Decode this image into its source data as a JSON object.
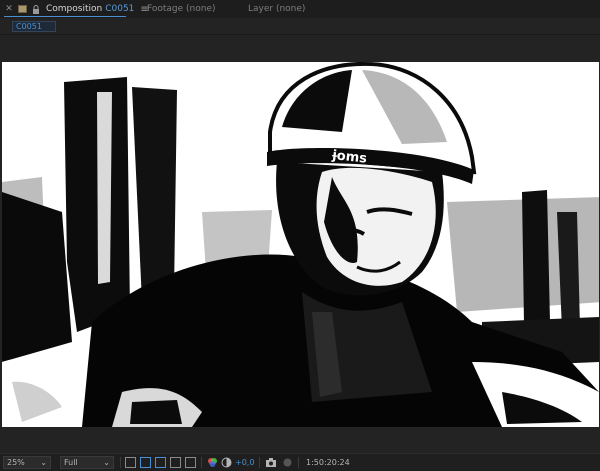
{
  "tabs": {
    "composition": {
      "title": "Composition",
      "name": "C0051",
      "menu_icon": "hamburger-menu-icon"
    },
    "footage": {
      "label": "Footage (none)"
    },
    "layer": {
      "label": "Layer (none)"
    }
  },
  "breadcrumb": {
    "label": "C0051"
  },
  "toolbar": {
    "zoom": "25%",
    "resolution": "Full",
    "exposure": "+0,0",
    "timecode": "1:50:20:24"
  },
  "colors": {
    "accent": "#4a8fd4",
    "panel": "#232323",
    "tab_bar": "#1d1d1d"
  }
}
